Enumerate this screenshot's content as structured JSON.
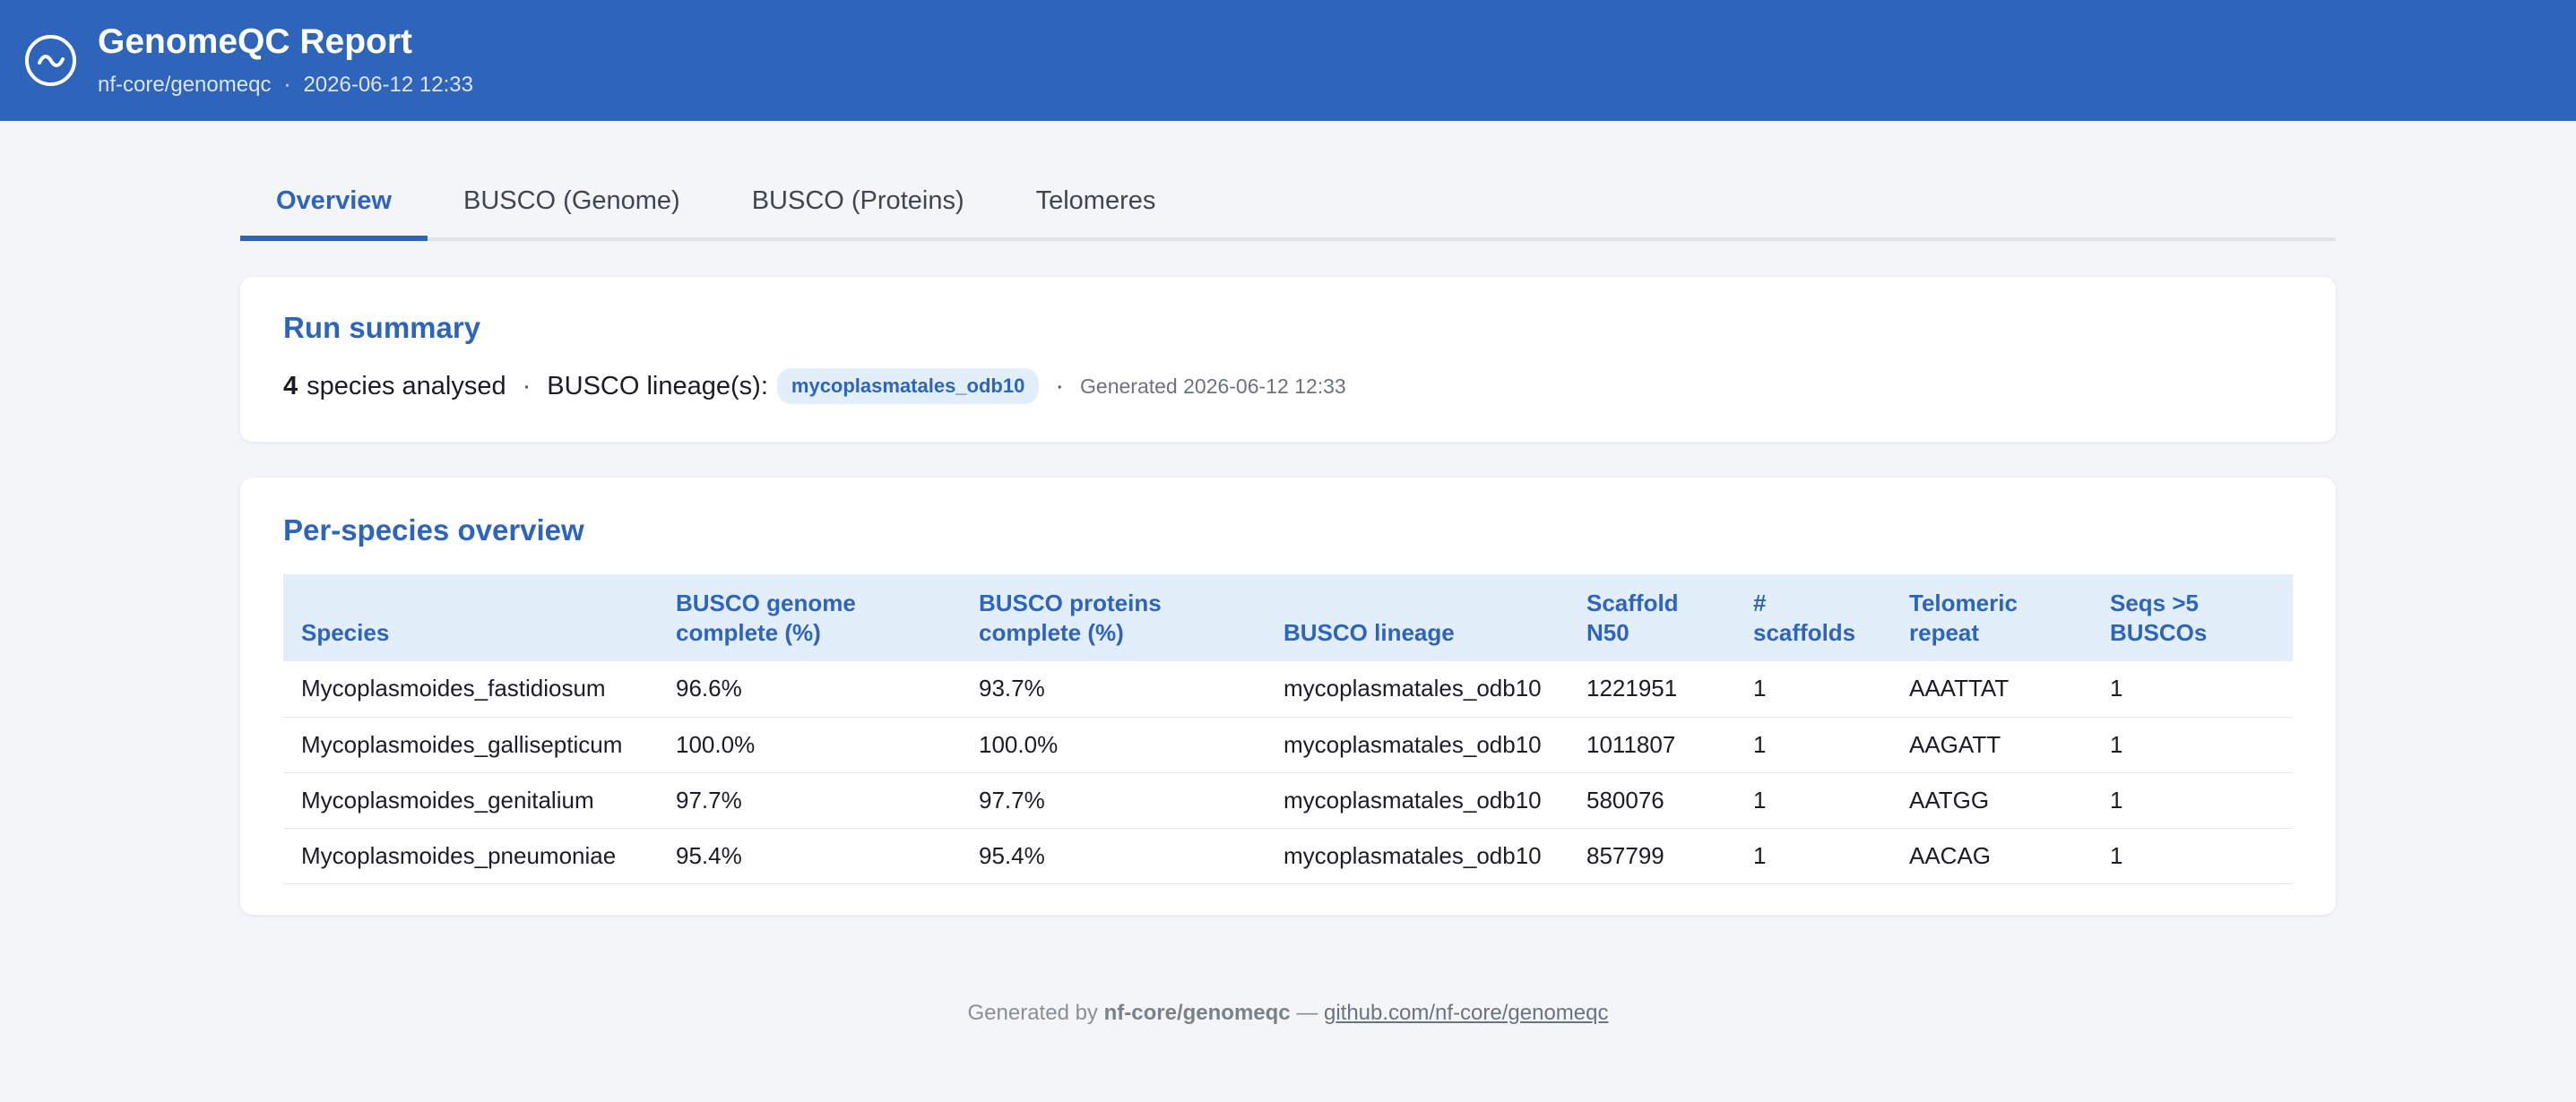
{
  "header": {
    "title": "GenomeQC Report",
    "pipeline": "nf-core/genomeqc",
    "separator": "·",
    "datetime": "2026-06-12 12:33",
    "logo_icon": "wave-circle-icon"
  },
  "tabs": [
    {
      "label": "Overview",
      "active": true
    },
    {
      "label": "BUSCO (Genome)",
      "active": false
    },
    {
      "label": "BUSCO (Proteins)",
      "active": false
    },
    {
      "label": "Telomeres",
      "active": false
    }
  ],
  "summary": {
    "heading": "Run summary",
    "species_count": "4",
    "species_text": "species analysed",
    "sep": "·",
    "lineage_label": "BUSCO lineage(s):",
    "lineage_value": "mycoplasmatales_odb10",
    "generated": "Generated 2026-06-12 12:33"
  },
  "overview": {
    "heading": "Per-species overview",
    "columns": [
      "Species",
      "BUSCO genome complete (%)",
      "BUSCO proteins complete (%)",
      "BUSCO lineage",
      "Scaffold N50",
      "# scaffolds",
      "Telomeric repeat",
      "Seqs >5 BUSCOs"
    ],
    "rows": [
      [
        "Mycoplasmoides_fastidiosum",
        "96.6%",
        "93.7%",
        "mycoplasmatales_odb10",
        "1221951",
        "1",
        "AAATTAT",
        "1"
      ],
      [
        "Mycoplasmoides_gallisepticum",
        "100.0%",
        "100.0%",
        "mycoplasmatales_odb10",
        "1011807",
        "1",
        "AAGATT",
        "1"
      ],
      [
        "Mycoplasmoides_genitalium",
        "97.7%",
        "97.7%",
        "mycoplasmatales_odb10",
        "580076",
        "1",
        "AATGG",
        "1"
      ],
      [
        "Mycoplasmoides_pneumoniae",
        "95.4%",
        "95.4%",
        "mycoplasmatales_odb10",
        "857799",
        "1",
        "AACAG",
        "1"
      ]
    ]
  },
  "footer": {
    "prefix": "Generated by",
    "name": "nf-core/genomeqc",
    "dash": "—",
    "link": "github.com/nf-core/genomeqc"
  },
  "colors": {
    "brand": "#2f64bb",
    "header_bg": "#2f64bb",
    "page_bg": "#f3f5f9",
    "table_header_bg": "#e3eefb"
  }
}
